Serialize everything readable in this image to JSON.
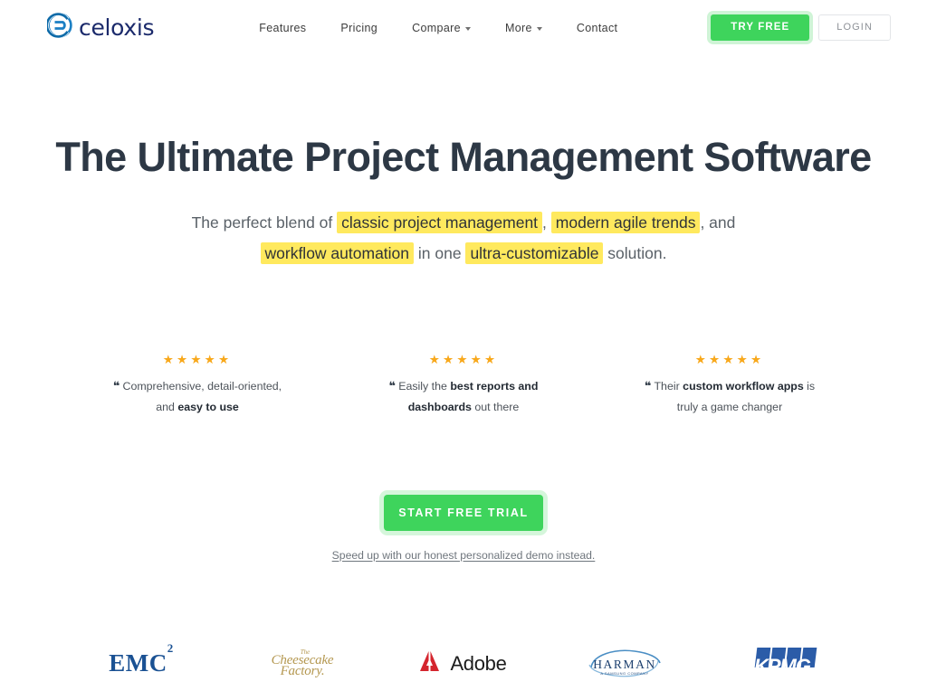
{
  "header": {
    "logo": {
      "text": "celoxis",
      "icon": "celoxis-circle-icon",
      "color": "#1b2a6b"
    },
    "nav": [
      {
        "label": "Features",
        "has_dropdown": false
      },
      {
        "label": "Pricing",
        "has_dropdown": false
      },
      {
        "label": "Compare",
        "has_dropdown": true
      },
      {
        "label": "More",
        "has_dropdown": true
      },
      {
        "label": "Contact",
        "has_dropdown": false
      }
    ],
    "try_free_label": "TRY FREE",
    "login_label": "LOGIN",
    "accent_green": "#3ed45c"
  },
  "hero": {
    "headline": "The Ultimate Project Management Software",
    "subhead": {
      "p1": "The perfect blend of ",
      "h1": "classic project management",
      "p2": ", ",
      "h2": "modern agile trends",
      "p3": ", and ",
      "h3": "workflow automation",
      "p4": " in one ",
      "h4": "ultra-customizable",
      "p5": " solution.",
      "highlight_color": "#ffe95e"
    }
  },
  "testimonials": {
    "star_color": "#f8a81b",
    "items": [
      {
        "stars": "★★★★★",
        "rating": 5,
        "quote_mark": "❝",
        "line1_plain": "Comprehensive, detail-oriented,",
        "line2_plain": "and ",
        "line2_bold": "easy to use"
      },
      {
        "stars": "★★★★★",
        "rating": 5,
        "quote_mark": "❝",
        "line1_plain": "Easily the ",
        "line1_bold": "best reports and",
        "line2_bold": "dashboards",
        "line2_plain": " out there"
      },
      {
        "stars": "★★★★★",
        "rating": 5,
        "quote_mark": "❝",
        "line1_plain": "Their ",
        "line1_bold": "custom workflow apps",
        "line1_tail": " is",
        "line2_plain": "truly a game changer"
      }
    ]
  },
  "cta": {
    "button_label": "START FREE TRIAL",
    "demo_link": "Speed up with our honest personalized demo instead."
  },
  "clients": [
    {
      "name": "EMC",
      "superscript": "2",
      "color": "#1a5193"
    },
    {
      "name_the": "The",
      "name_l1": "Cheesecake",
      "name_l2": "Factory.",
      "color": "#b4974f"
    },
    {
      "name": "Adobe",
      "color": "#1c1c1c",
      "mark_color": "#d4252e"
    },
    {
      "name": "HARMAN",
      "sub": "A SAMSUNG COMPANY",
      "color": "#1c3f6e"
    },
    {
      "name": "KPMG",
      "color": "#2b5ca8"
    }
  ]
}
